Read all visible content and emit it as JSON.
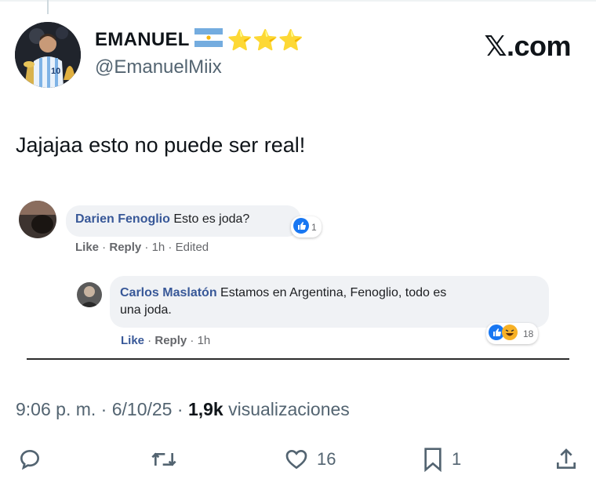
{
  "author": {
    "display_name": "EMANUEL",
    "handle": "@EmanuelMiix",
    "stars": "⭐⭐⭐"
  },
  "brand": {
    "logo_text": "𝕏.com"
  },
  "tweet": {
    "text": "Jajajaa esto no puede ser real!"
  },
  "quoted_screenshot": {
    "comment1": {
      "author": "Darien Fenoglio",
      "text": "Esto es joda?",
      "reaction_count": "1",
      "meta": {
        "like": "Like",
        "reply": "Reply",
        "time": "1h",
        "edited": "Edited"
      }
    },
    "comment2": {
      "author": "Carlos Maslatón",
      "text_line1": "Estamos en Argentina, Fenoglio, todo es",
      "text_line2": "una joda.",
      "reaction_count": "18",
      "meta": {
        "like": "Like",
        "reply": "Reply",
        "time": "1h"
      }
    }
  },
  "timestamp": {
    "time": "9:06 p. m.",
    "date": "6/10/25",
    "views_count": "1,9k",
    "views_label": "visualizaciones"
  },
  "actions": {
    "replies": "",
    "reposts": "",
    "likes": "16",
    "bookmarks": "1"
  },
  "colors": {
    "fb_link": "#385898",
    "x_gray": "#536471",
    "like_blue": "#1877f2"
  }
}
